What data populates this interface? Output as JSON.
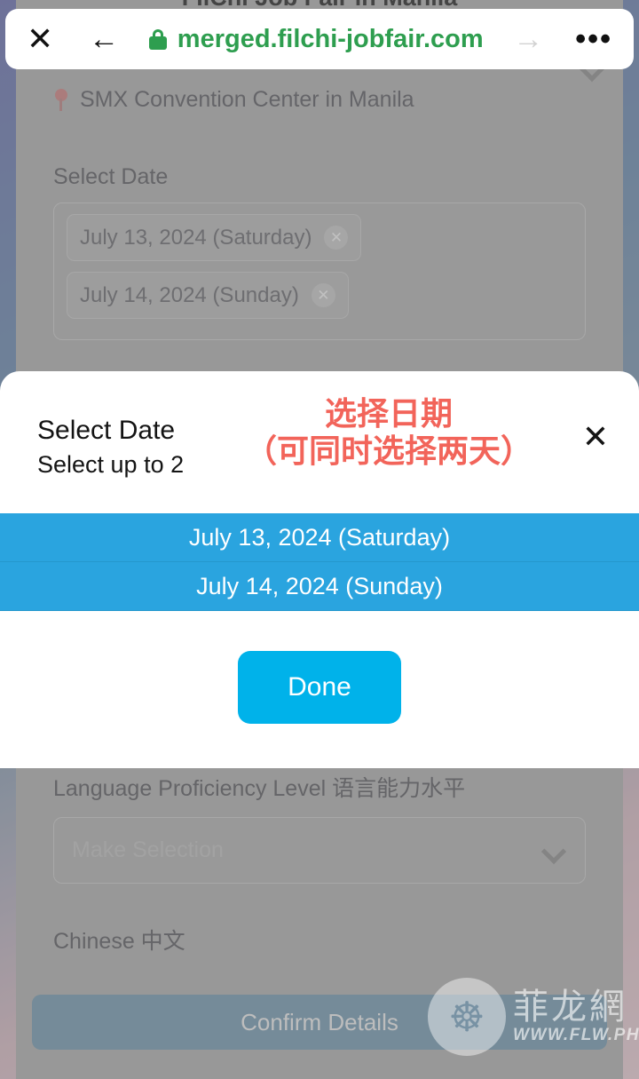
{
  "browser": {
    "close_label": "✕",
    "back_label": "←",
    "lock_icon": "lock-icon",
    "url": "merged.filchi-jobfair.com",
    "forward_label": "→",
    "menu_label": "•••",
    "url_color": "#2e9e4f"
  },
  "background": {
    "page_title": "FilChi Job Fair in Manila",
    "venue": "SMX Convention Center in Manila",
    "venue_icon": "map-pin-icon",
    "select_date_label": "Select Date",
    "selected_dates": [
      {
        "label": "July 13, 2024 (Saturday)",
        "remove_icon": "✕"
      },
      {
        "label": "July 14, 2024 (Sunday)",
        "remove_icon": "✕"
      }
    ],
    "language_label": "Language Proficiency Level 语言能力水平",
    "language_placeholder": "Make Selection",
    "chinese_label": "Chinese 中文",
    "confirm_button": "Confirm Details"
  },
  "watermark": {
    "dragon_icon": "dragon-logo-icon",
    "site_name_cn": "菲龙網",
    "site_url": "WWW.FLW.PH"
  },
  "modal": {
    "title": "Select Date",
    "subtitle": "Select up to 2",
    "annotation_line1": "选择日期",
    "annotation_line2": "（可同时选择两天）",
    "annotation_color": "#f2645a",
    "close_label": "✕",
    "options": [
      {
        "label": "July 13, 2024 (Saturday)",
        "selected": true
      },
      {
        "label": "July 14, 2024 (Sunday)",
        "selected": true
      }
    ],
    "done_label": "Done",
    "selected_color": "#2aa4df",
    "done_color": "#00b2ea"
  }
}
